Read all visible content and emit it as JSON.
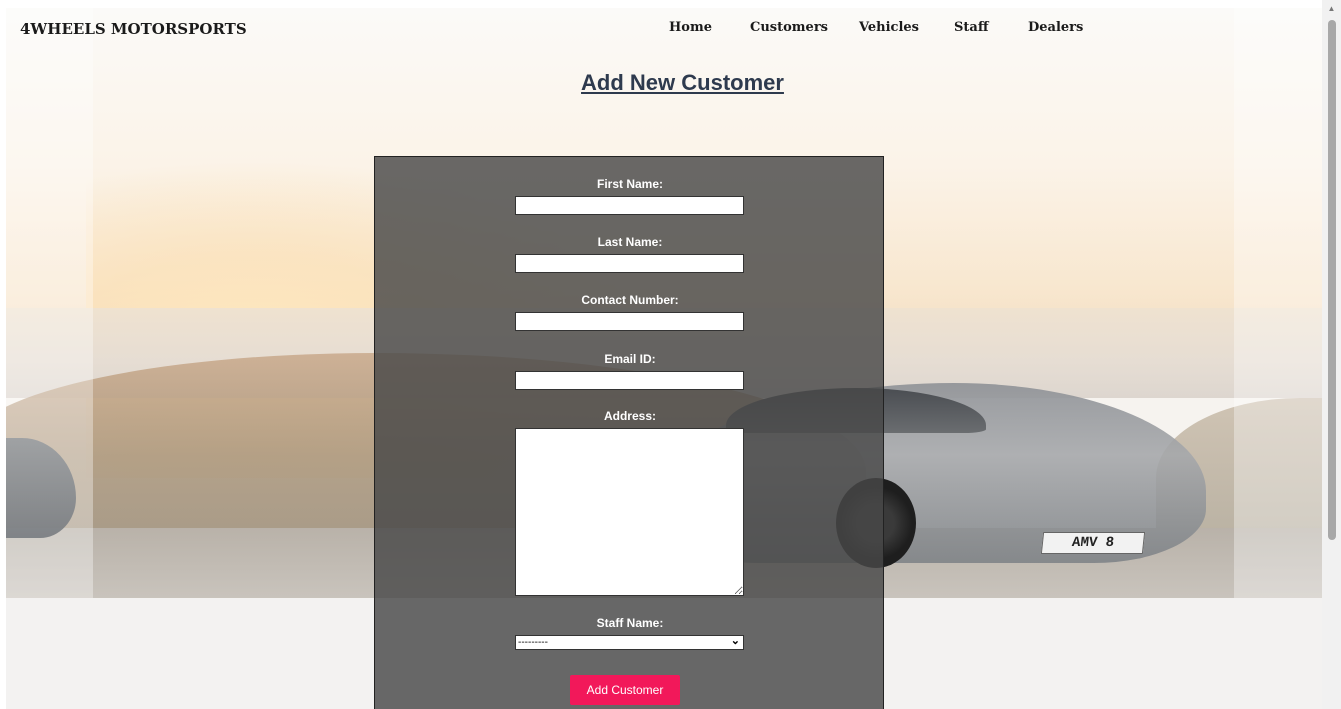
{
  "brand": "4WHEELS MOTORSPORTS",
  "nav": {
    "items": [
      {
        "label": "Home"
      },
      {
        "label": "Customers"
      },
      {
        "label": "Vehicles"
      },
      {
        "label": "Staff"
      },
      {
        "label": "Dealers"
      }
    ]
  },
  "page_title": "Add New Customer",
  "background": {
    "plate_text": "AMV 8"
  },
  "form": {
    "fields": {
      "first_name": {
        "label": "First Name:",
        "value": ""
      },
      "last_name": {
        "label": "Last Name:",
        "value": ""
      },
      "contact_number": {
        "label": "Contact Number:",
        "value": ""
      },
      "email_id": {
        "label": "Email ID:",
        "value": ""
      },
      "address": {
        "label": "Address:",
        "value": ""
      },
      "staff_name": {
        "label": "Staff Name:",
        "selected": "---------"
      }
    },
    "submit_label": "Add Customer"
  },
  "colors": {
    "accent": "#f2185a",
    "title": "#2e3a4e",
    "panel": "#484848"
  }
}
